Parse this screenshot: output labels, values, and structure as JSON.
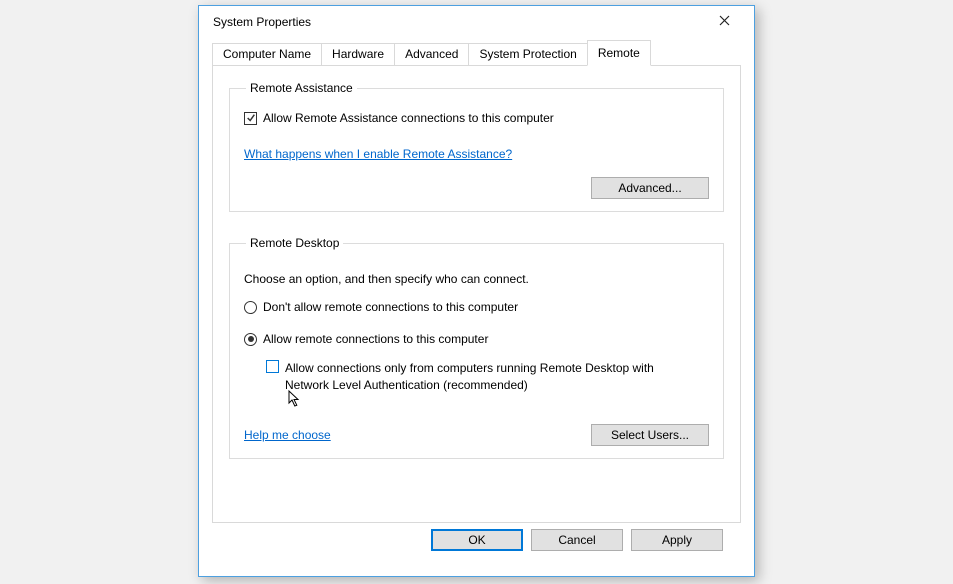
{
  "window": {
    "title": "System Properties"
  },
  "tabs": {
    "items": [
      "Computer Name",
      "Hardware",
      "Advanced",
      "System Protection",
      "Remote"
    ],
    "active_index": 4
  },
  "remote_assistance": {
    "legend": "Remote Assistance",
    "allow_label": "Allow Remote Assistance connections to this computer",
    "allow_checked": true,
    "help_link": "What happens when I enable Remote Assistance?",
    "advanced_button": "Advanced..."
  },
  "remote_desktop": {
    "legend": "Remote Desktop",
    "instruction": "Choose an option, and then specify who can connect.",
    "option_dont_allow": "Don't allow remote connections to this computer",
    "option_allow": "Allow remote connections to this computer",
    "selected_option": "allow",
    "nla_label": "Allow connections only from computers running Remote Desktop with Network Level Authentication (recommended)",
    "nla_checked": false,
    "help_link": "Help me choose",
    "select_users_button": "Select Users..."
  },
  "buttons": {
    "ok": "OK",
    "cancel": "Cancel",
    "apply": "Apply"
  }
}
